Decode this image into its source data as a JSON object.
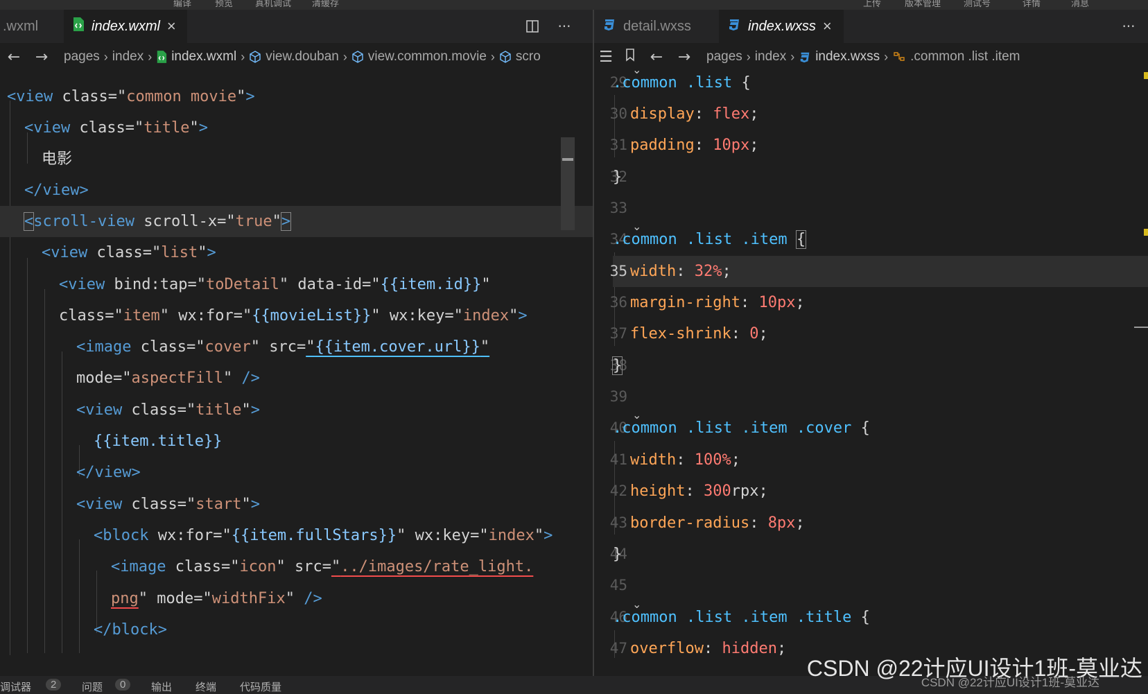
{
  "top_strip": {
    "items": [
      "编译",
      "预览",
      "真机调试",
      "清缓存",
      "上传",
      "版本管理",
      "测试号",
      "详情",
      "消息"
    ]
  },
  "left": {
    "tabs": [
      {
        "label": ".wxml"
      },
      {
        "label": "index.wxml",
        "close": "×"
      }
    ],
    "breadcrumb": [
      "pages",
      "index",
      "index.wxml",
      "view.douban",
      "view.common.movie",
      "scro"
    ]
  },
  "right": {
    "tabs": [
      {
        "label": "detail.wxss"
      },
      {
        "label": "index.wxss",
        "close": "×"
      }
    ],
    "breadcrumb": [
      "pages",
      "index",
      "index.wxss",
      ".common .list .item"
    ]
  },
  "status": {
    "items": [
      "调试器",
      "2",
      "问题",
      "0",
      "输出",
      "终端",
      "代码质量"
    ]
  },
  "watermark": {
    "text": "CSDN @22计应UI设计1班-莫业达",
    "shadow": "CSDN @22计应UI设计1班-莫业达"
  }
}
